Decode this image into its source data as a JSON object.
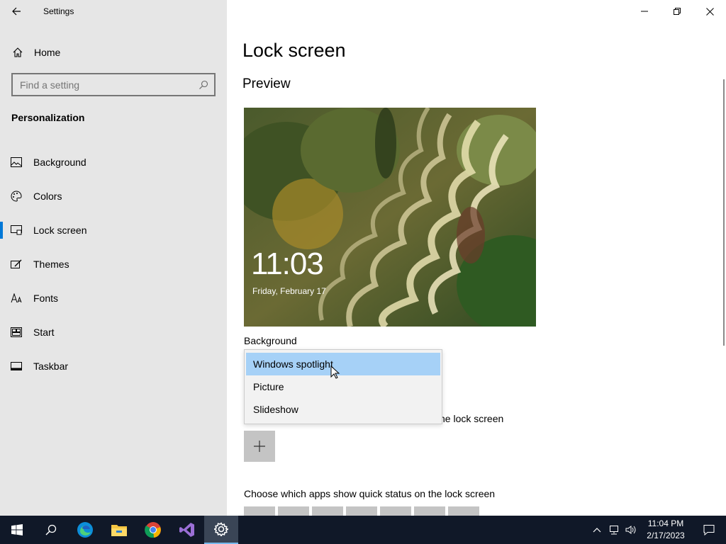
{
  "window": {
    "title": "Settings"
  },
  "sidebar": {
    "home_label": "Home",
    "search_placeholder": "Find a setting",
    "section_title": "Personalization",
    "items": [
      {
        "label": "Background",
        "icon": "picture-icon"
      },
      {
        "label": "Colors",
        "icon": "palette-icon"
      },
      {
        "label": "Lock screen",
        "icon": "lock-screen-icon",
        "active": true
      },
      {
        "label": "Themes",
        "icon": "themes-icon"
      },
      {
        "label": "Fonts",
        "icon": "fonts-icon"
      },
      {
        "label": "Start",
        "icon": "start-icon"
      },
      {
        "label": "Taskbar",
        "icon": "taskbar-icon"
      }
    ]
  },
  "main": {
    "page_title": "Lock screen",
    "preview_title": "Preview",
    "lockscreen_time": "11:03",
    "lockscreen_date": "Friday, February 17",
    "background_label": "Background",
    "dropdown": {
      "options": [
        "Windows spotlight",
        "Picture",
        "Slideshow"
      ],
      "selected": "Windows spotlight"
    },
    "detailed_status_partial": "he lock screen",
    "quick_status_label": "Choose which apps show quick status on the lock screen"
  },
  "taskbar": {
    "apps": [
      "start-icon",
      "search-icon",
      "edge-icon",
      "file-explorer-icon",
      "chrome-icon",
      "visual-studio-icon",
      "settings-icon"
    ],
    "time": "11:04 PM",
    "date": "2/17/2023"
  },
  "colors": {
    "accent": "#0078d7",
    "sidebar_bg": "#e6e6e6",
    "taskbar_bg": "#101828",
    "dropdown_selected": "#a6d1f7"
  }
}
